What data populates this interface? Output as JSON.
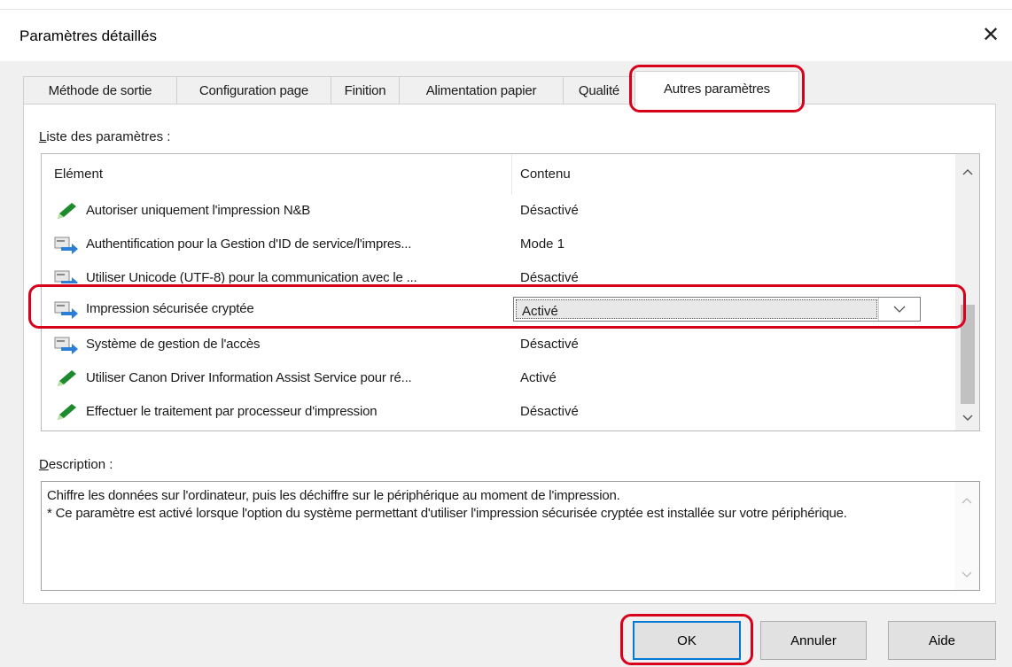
{
  "window": {
    "title": "Paramètres détaillés",
    "close_glyph": "✕"
  },
  "tabs": [
    {
      "label": "Méthode de sortie"
    },
    {
      "label": "Configuration page"
    },
    {
      "label": "Finition"
    },
    {
      "label": "Alimentation papier"
    },
    {
      "label": "Qualité"
    },
    {
      "label": "Autres paramètres",
      "active": true
    }
  ],
  "settings_list": {
    "label_accel": "L",
    "label_rest": "iste des paramètres :",
    "columns": {
      "item": "Elément",
      "content": "Contenu"
    },
    "rows": [
      {
        "icon": "pencil-icon",
        "name": "Autoriser uniquement l'impression N&B",
        "value": "Désactivé"
      },
      {
        "icon": "device-arrow-icon",
        "name": "Authentification pour la Gestion d'ID de service/l'impres...",
        "value": "Mode 1"
      },
      {
        "icon": "device-arrow-icon",
        "name": "Utiliser Unicode (UTF-8) pour la communication avec le ...",
        "value": "Désactivé"
      },
      {
        "icon": "device-arrow-icon",
        "name": "Impression sécurisée cryptée",
        "value": "Activé",
        "selected": true
      },
      {
        "icon": "device-arrow-icon",
        "name": "Système de gestion de l'accès",
        "value": "Désactivé"
      },
      {
        "icon": "pencil-icon",
        "name": "Utiliser Canon Driver Information Assist Service pour ré...",
        "value": "Activé"
      },
      {
        "icon": "pencil-icon",
        "name": "Effectuer le traitement par processeur d'impression",
        "value": "Désactivé"
      }
    ]
  },
  "description": {
    "label_accel": "D",
    "label_rest": "escription :",
    "text_line1": "Chiffre les données sur l'ordinateur, puis les déchiffre sur le périphérique au moment de l'impression.",
    "text_line2": "* Ce paramètre est activé lorsque l'option du système permettant d'utiliser l'impression sécurisée cryptée est installée sur votre périphérique."
  },
  "buttons": {
    "ok": "OK",
    "cancel": "Annuler",
    "help": "Aide"
  },
  "colors": {
    "highlight": "#d9001b",
    "pencil": "#1e8a2e",
    "device_arrow": "#2b7fd8"
  }
}
